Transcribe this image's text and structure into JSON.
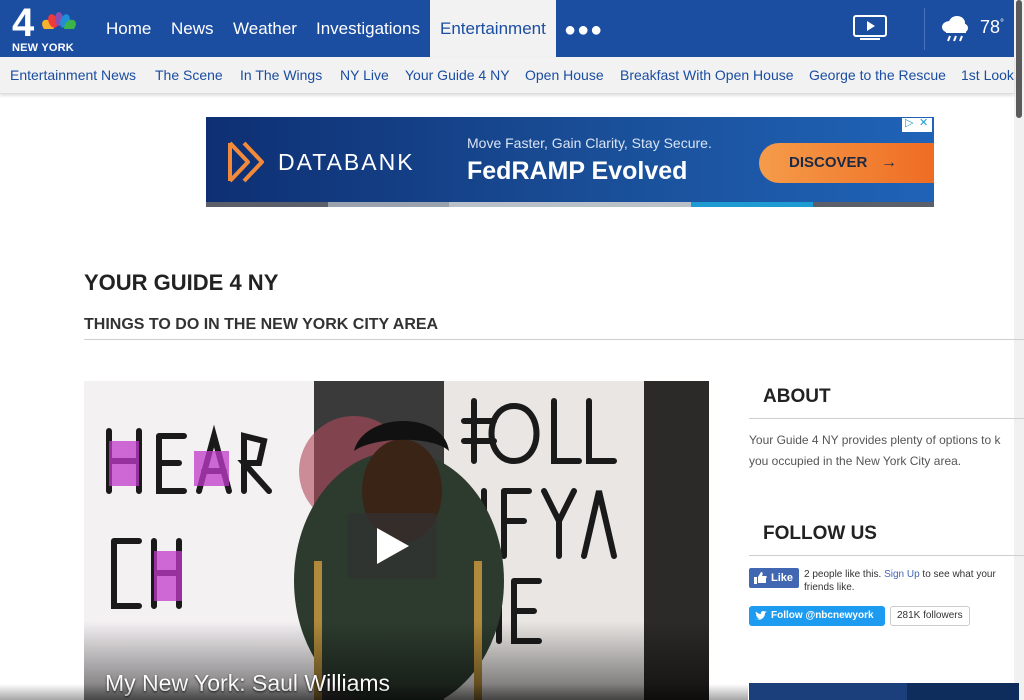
{
  "site": {
    "logo_number": "4",
    "logo_city": "NEW YORK"
  },
  "topnav": {
    "items": [
      {
        "label": "Home"
      },
      {
        "label": "News"
      },
      {
        "label": "Weather"
      },
      {
        "label": "Investigations"
      },
      {
        "label": "Entertainment",
        "active": true
      }
    ],
    "more_icon": "more-dots-icon",
    "video_icon": "video-player-icon",
    "weather_icon": "rain-cloud-icon",
    "temperature": "78",
    "temperature_unit": "°"
  },
  "subnav": {
    "items": [
      {
        "label": "Entertainment News"
      },
      {
        "label": "The Scene"
      },
      {
        "label": "In The Wings"
      },
      {
        "label": "NY Live"
      },
      {
        "label": "Your Guide 4 NY"
      },
      {
        "label": "Open House"
      },
      {
        "label": "Breakfast With Open House"
      },
      {
        "label": "George to the Rescue"
      },
      {
        "label": "1st Look"
      }
    ]
  },
  "ad": {
    "brand": "DATABANK",
    "line1": "Move Faster, Gain Clarity, Stay Secure.",
    "line2": "FedRAMP Evolved",
    "cta": "DISCOVER",
    "cta_arrow": "→",
    "adchoices": "▷",
    "close": "✕"
  },
  "main": {
    "title": "YOUR GUIDE 4 NY",
    "subtitle": "THINGS TO DO IN THE NEW YORK CITY AREA",
    "video": {
      "title": "My New York: Saul Williams"
    }
  },
  "sidebar": {
    "about_heading": "ABOUT",
    "about_line1": "Your Guide 4 NY provides plenty of options to k",
    "about_line2": "you occupied in the New York City area.",
    "follow_heading": "FOLLOW US",
    "fb_like_label": "Like",
    "fb_text_prefix": "2 people like this.",
    "fb_signup": "Sign Up",
    "fb_text_suffix": "to see what your friends like.",
    "twitter_follow_label": "Follow @nbcnewyork",
    "twitter_followers": "281K followers"
  },
  "colors": {
    "brand_blue": "#1b4da1",
    "ad_orange": "#f28a3a",
    "twitter_blue": "#1d9bf0",
    "facebook_blue": "#4267b2"
  }
}
